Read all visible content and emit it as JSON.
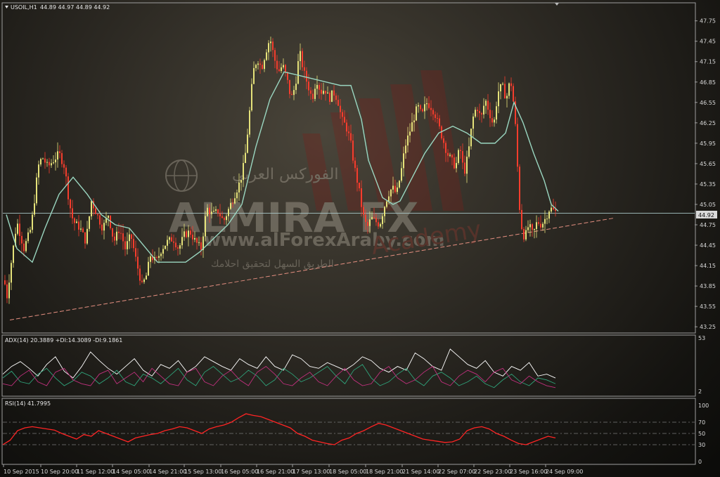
{
  "chart_data": [
    {
      "type": "candlestick",
      "symbol_label": "USOIL,H1",
      "ohlc_header": "44.89 44.97 44.89 44.92",
      "current_price": "44.92",
      "y_ticks": [
        "47.75",
        "47.45",
        "47.15",
        "46.85",
        "46.55",
        "46.25",
        "45.95",
        "45.65",
        "45.35",
        "45.05",
        "44.75",
        "44.45",
        "44.15",
        "43.85",
        "43.55",
        "43.25"
      ],
      "ylim": [
        43.2,
        47.85
      ],
      "x_ticks": [
        "10 Sep 2015",
        "10 Sep 20:00",
        "11 Sep 12:00",
        "14 Sep 05:00",
        "14 Sep 21:00",
        "15 Sep 13:00",
        "16 Sep 05:00",
        "16 Sep 21:00",
        "17 Sep 13:00",
        "18 Sep 05:00",
        "18 Sep 21:00",
        "21 Sep 14:00",
        "22 Sep 07:00",
        "22 Sep 23:00",
        "23 Sep 16:00",
        "24 Sep 09:00"
      ],
      "close_path": [
        [
          0,
          44.05
        ],
        [
          6,
          43.7
        ],
        [
          12,
          44.2
        ],
        [
          20,
          44.8
        ],
        [
          30,
          44.4
        ],
        [
          40,
          44.7
        ],
        [
          46,
          45.2
        ],
        [
          50,
          45.6
        ],
        [
          56,
          45.75
        ],
        [
          64,
          45.6
        ],
        [
          72,
          45.7
        ],
        [
          80,
          45.8
        ],
        [
          88,
          45.6
        ],
        [
          94,
          45.1
        ],
        [
          100,
          44.8
        ],
        [
          110,
          44.7
        ],
        [
          118,
          44.5
        ],
        [
          126,
          45.1
        ],
        [
          134,
          44.9
        ],
        [
          142,
          44.7
        ],
        [
          150,
          44.9
        ],
        [
          158,
          44.5
        ],
        [
          166,
          44.7
        ],
        [
          174,
          44.4
        ],
        [
          182,
          44.6
        ],
        [
          190,
          44.2
        ],
        [
          198,
          43.85
        ],
        [
          204,
          44.0
        ],
        [
          210,
          44.3
        ],
        [
          218,
          44.2
        ],
        [
          226,
          44.4
        ],
        [
          234,
          44.5
        ],
        [
          242,
          44.55
        ],
        [
          250,
          44.4
        ],
        [
          258,
          44.6
        ],
        [
          266,
          44.65
        ],
        [
          274,
          44.5
        ],
        [
          282,
          44.4
        ],
        [
          290,
          45.0
        ],
        [
          298,
          44.9
        ],
        [
          306,
          44.95
        ],
        [
          314,
          44.8
        ],
        [
          322,
          45.0
        ],
        [
          330,
          45.2
        ],
        [
          338,
          45.4
        ],
        [
          344,
          45.7
        ],
        [
          350,
          46.3
        ],
        [
          356,
          47.0
        ],
        [
          362,
          47.2
        ],
        [
          368,
          47.05
        ],
        [
          374,
          47.3
        ],
        [
          380,
          47.5
        ],
        [
          386,
          47.2
        ],
        [
          392,
          47.0
        ],
        [
          398,
          47.1
        ],
        [
          404,
          46.9
        ],
        [
          410,
          46.6
        ],
        [
          416,
          46.8
        ],
        [
          422,
          47.3
        ],
        [
          428,
          47.0
        ],
        [
          434,
          46.8
        ],
        [
          440,
          46.6
        ],
        [
          446,
          46.9
        ],
        [
          452,
          46.7
        ],
        [
          458,
          46.75
        ],
        [
          464,
          46.6
        ],
        [
          470,
          46.7
        ],
        [
          476,
          46.6
        ],
        [
          482,
          46.3
        ],
        [
          488,
          46.2
        ],
        [
          494,
          46.0
        ],
        [
          500,
          45.6
        ],
        [
          506,
          45.3
        ],
        [
          512,
          44.9
        ],
        [
          518,
          44.7
        ],
        [
          524,
          44.85
        ],
        [
          530,
          44.8
        ],
        [
          536,
          44.75
        ],
        [
          542,
          45.0
        ],
        [
          548,
          45.2
        ],
        [
          554,
          45.3
        ],
        [
          560,
          45.2
        ],
        [
          566,
          45.5
        ],
        [
          572,
          45.9
        ],
        [
          578,
          46.1
        ],
        [
          584,
          46.3
        ],
        [
          590,
          46.5
        ],
        [
          596,
          46.35
        ],
        [
          602,
          46.55
        ],
        [
          608,
          46.5
        ],
        [
          614,
          46.4
        ],
        [
          620,
          46.2
        ],
        [
          626,
          46.0
        ],
        [
          632,
          45.8
        ],
        [
          638,
          45.7
        ],
        [
          644,
          45.6
        ],
        [
          650,
          45.9
        ],
        [
          656,
          45.5
        ],
        [
          662,
          45.8
        ],
        [
          668,
          46.3
        ],
        [
          674,
          46.5
        ],
        [
          680,
          46.3
        ],
        [
          686,
          46.6
        ],
        [
          692,
          46.4
        ],
        [
          698,
          46.2
        ],
        [
          704,
          46.7
        ],
        [
          710,
          46.8
        ],
        [
          716,
          46.6
        ],
        [
          722,
          46.9
        ],
        [
          728,
          46.4
        ],
        [
          732,
          45.6
        ],
        [
          736,
          44.8
        ],
        [
          742,
          44.55
        ],
        [
          748,
          44.75
        ],
        [
          754,
          44.6
        ],
        [
          760,
          44.8
        ],
        [
          766,
          44.75
        ],
        [
          772,
          44.85
        ],
        [
          778,
          45.0
        ],
        [
          784,
          44.95
        ],
        [
          790,
          44.92
        ]
      ],
      "moving_average": [
        [
          5,
          44.9
        ],
        [
          20,
          44.4
        ],
        [
          42,
          44.2
        ],
        [
          60,
          44.7
        ],
        [
          80,
          45.2
        ],
        [
          100,
          45.45
        ],
        [
          120,
          45.2
        ],
        [
          140,
          44.9
        ],
        [
          160,
          44.75
        ],
        [
          180,
          44.7
        ],
        [
          200,
          44.45
        ],
        [
          220,
          44.2
        ],
        [
          240,
          44.2
        ],
        [
          260,
          44.2
        ],
        [
          280,
          44.35
        ],
        [
          300,
          44.55
        ],
        [
          320,
          44.75
        ],
        [
          340,
          45.05
        ],
        [
          360,
          45.9
        ],
        [
          380,
          46.6
        ],
        [
          400,
          47.0
        ],
        [
          420,
          46.95
        ],
        [
          440,
          46.9
        ],
        [
          460,
          46.85
        ],
        [
          480,
          46.8
        ],
        [
          495,
          46.8
        ],
        [
          510,
          46.3
        ],
        [
          520,
          45.7
        ],
        [
          540,
          45.15
        ],
        [
          555,
          45.05
        ],
        [
          565,
          45.1
        ],
        [
          580,
          45.4
        ],
        [
          600,
          45.8
        ],
        [
          620,
          46.1
        ],
        [
          640,
          46.2
        ],
        [
          660,
          46.1
        ],
        [
          680,
          45.95
        ],
        [
          700,
          45.95
        ],
        [
          715,
          46.1
        ],
        [
          727,
          46.55
        ],
        [
          740,
          46.25
        ],
        [
          755,
          45.8
        ],
        [
          770,
          45.4
        ],
        [
          780,
          45.05
        ],
        [
          790,
          44.95
        ]
      ],
      "trendline": [
        [
          10,
          43.35
        ],
        [
          870,
          44.85
        ]
      ]
    },
    {
      "type": "line",
      "label": "ADX(14) 20.3889 +DI:14.3089 -DI:9.1861",
      "y_ticks": [
        "53",
        "2"
      ],
      "ylim": [
        2,
        53
      ],
      "series": [
        {
          "color": "#ffffff",
          "values": [
            22,
            30,
            35,
            28,
            20,
            32,
            40,
            25,
            18,
            30,
            45,
            36,
            28,
            22,
            30,
            38,
            26,
            20,
            32,
            28,
            36,
            24,
            30,
            40,
            35,
            30,
            26,
            38,
            32,
            28,
            40,
            30,
            26,
            42,
            38,
            30,
            28,
            34,
            30,
            26,
            32,
            40,
            36,
            28,
            24,
            30,
            26,
            44,
            38,
            30,
            26,
            48,
            40,
            32,
            28,
            36,
            24,
            20,
            30,
            26,
            34,
            20,
            22,
            18
          ]
        },
        {
          "color": "#2fa37a",
          "values": [
            18,
            25,
            14,
            12,
            22,
            28,
            18,
            10,
            15,
            24,
            20,
            12,
            18,
            26,
            14,
            10,
            22,
            18,
            12,
            20,
            28,
            16,
            10,
            24,
            30,
            22,
            14,
            18,
            26,
            20,
            10,
            16,
            28,
            22,
            14,
            18,
            24,
            30,
            20,
            12,
            26,
            32,
            18,
            10,
            14,
            22,
            28,
            16,
            10,
            20,
            24,
            18,
            10,
            14,
            20,
            12,
            8,
            16,
            22,
            14,
            10,
            18,
            16,
            12
          ]
        },
        {
          "color": "#c2307e",
          "values": [
            12,
            10,
            20,
            26,
            14,
            10,
            24,
            28,
            16,
            12,
            10,
            22,
            26,
            12,
            18,
            24,
            14,
            28,
            20,
            12,
            10,
            24,
            28,
            14,
            10,
            20,
            26,
            16,
            10,
            24,
            30,
            22,
            12,
            10,
            18,
            24,
            14,
            10,
            20,
            28,
            16,
            10,
            12,
            24,
            30,
            18,
            12,
            16,
            24,
            30,
            14,
            10,
            20,
            26,
            22,
            14,
            24,
            28,
            16,
            12,
            20,
            14,
            10,
            8
          ]
        }
      ]
    },
    {
      "type": "line",
      "label": "RSI(14) 41.7995",
      "y_ticks": [
        "100",
        "70",
        "50",
        "30",
        "0"
      ],
      "ylim": [
        0,
        100
      ],
      "levels": [
        70,
        50,
        30
      ],
      "series": [
        {
          "color": "#ff2424",
          "values": [
            30,
            38,
            55,
            60,
            62,
            60,
            58,
            56,
            50,
            45,
            40,
            48,
            45,
            55,
            50,
            45,
            40,
            35,
            42,
            45,
            48,
            50,
            55,
            58,
            62,
            60,
            55,
            50,
            58,
            62,
            65,
            70,
            78,
            85,
            82,
            80,
            75,
            70,
            65,
            60,
            50,
            45,
            38,
            35,
            32,
            30,
            38,
            42,
            50,
            55,
            62,
            68,
            65,
            60,
            55,
            50,
            45,
            40,
            38,
            36,
            34,
            35,
            40,
            55,
            60,
            62,
            58,
            50,
            45,
            38,
            32,
            30,
            35,
            40,
            45,
            42
          ]
        }
      ]
    }
  ],
  "watermark": {
    "brand": "ALMIRA FX",
    "site": "www.alForexAraby.com",
    "academy": "Academy",
    "tagline": "الطريق السهل لتحقيق احلامك",
    "arabic_logo": "الفوركس العربي"
  },
  "colors": {
    "bull_candle": "#e5e27a",
    "bear_candle": "#f53d2d",
    "ma_line": "#9ad6c0",
    "trendline": "#e48f80",
    "price_line": "#a9c7c7",
    "panel_border": "#9d9d9d",
    "level_line": "#7a7a7a"
  }
}
